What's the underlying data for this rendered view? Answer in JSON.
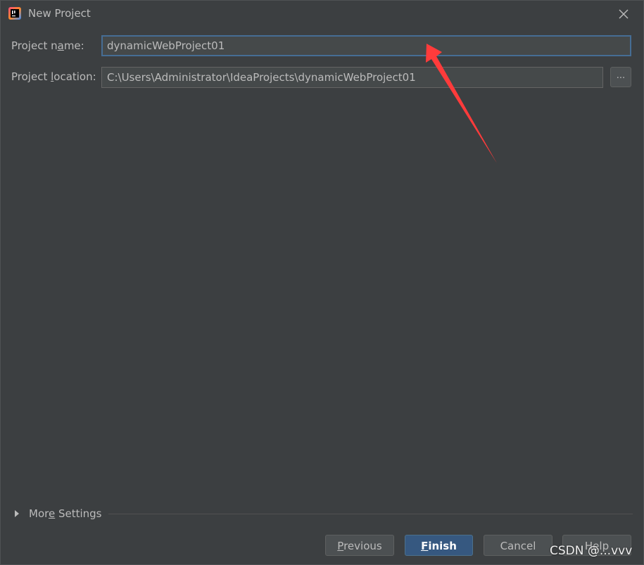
{
  "window": {
    "title": "New Project",
    "app_icon": "intellij-idea-icon",
    "close_icon": "close-icon"
  },
  "form": {
    "project_name": {
      "label_pre": "Project n",
      "label_mnemonic": "a",
      "label_post": "me:",
      "value": "dynamicWebProject01"
    },
    "project_location": {
      "label_pre": "Project ",
      "label_mnemonic": "l",
      "label_post": "ocation:",
      "value": "C:\\Users\\Administrator\\IdeaProjects\\dynamicWebProject01",
      "browse_label": "..."
    }
  },
  "more_settings": {
    "label_pre": "Mor",
    "label_mnemonic": "e",
    "label_post": " Settings",
    "icon": "triangle-right-icon"
  },
  "buttons": {
    "previous": {
      "mnemonic": "P",
      "rest": "revious"
    },
    "finish": {
      "mnemonic": "F",
      "rest": "inish"
    },
    "cancel": {
      "label": "Cancel"
    },
    "help": {
      "label": "Help"
    }
  },
  "annotation": {
    "arrow_color": "#ff3b3b"
  },
  "watermark": {
    "text": "CSDN @...vvv"
  },
  "colors": {
    "background": "#3c3f41",
    "field_background": "#45494a",
    "focus_border": "#466d94",
    "primary_button": "#365880",
    "text": "#bbbbbb"
  }
}
